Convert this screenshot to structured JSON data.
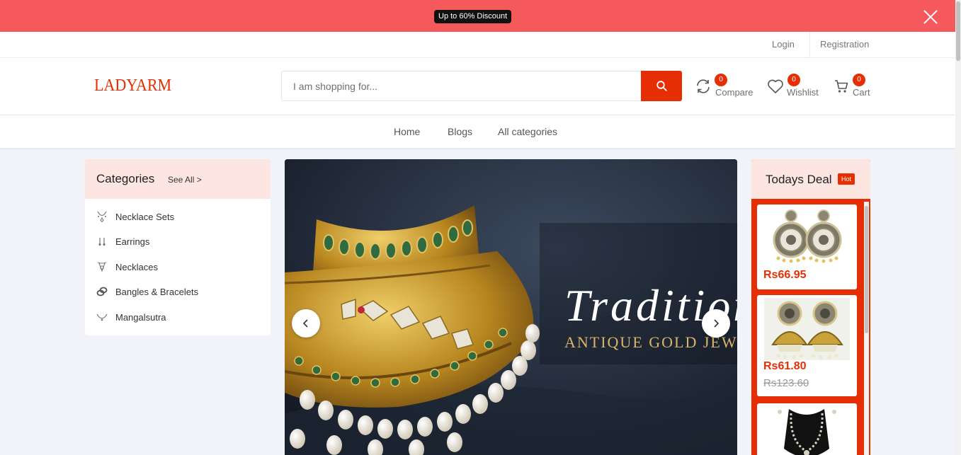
{
  "promo": {
    "text": "Up to 60% Discount"
  },
  "toplinks": {
    "login": "Login",
    "registration": "Registration"
  },
  "header": {
    "logo": "LADYARM",
    "search_placeholder": "I am shopping for...",
    "compare": {
      "label": "Compare",
      "count": "0"
    },
    "wishlist": {
      "label": "Wishlist",
      "count": "0"
    },
    "cart": {
      "label": "Cart",
      "count": "0"
    }
  },
  "nav": {
    "items": [
      "Home",
      "Blogs",
      "All categories"
    ]
  },
  "categories": {
    "title": "Categories",
    "see_all": "See All >",
    "items": [
      {
        "label": "Necklace Sets",
        "icon": "necklace-set-icon"
      },
      {
        "label": "Earrings",
        "icon": "earrings-icon"
      },
      {
        "label": "Necklaces",
        "icon": "necklace-icon"
      },
      {
        "label": "Bangles & Bracelets",
        "icon": "bangles-icon"
      },
      {
        "label": "Mangalsutra",
        "icon": "mangalsutra-icon"
      }
    ]
  },
  "slider": {
    "title": "Tradition",
    "subtitle": "ANTIQUE GOLD JEWELLERY"
  },
  "todays_deal": {
    "title": "Todays Deal",
    "badge": "Hot",
    "products": [
      {
        "price": "Rs66.95",
        "old_price": ""
      },
      {
        "price": "Rs61.80",
        "old_price": "Rs123.60"
      },
      {
        "price": "",
        "old_price": ""
      }
    ]
  },
  "colors": {
    "accent": "#e62e04",
    "promo_bg": "#f5595b",
    "panel_head": "#fde5e2"
  }
}
